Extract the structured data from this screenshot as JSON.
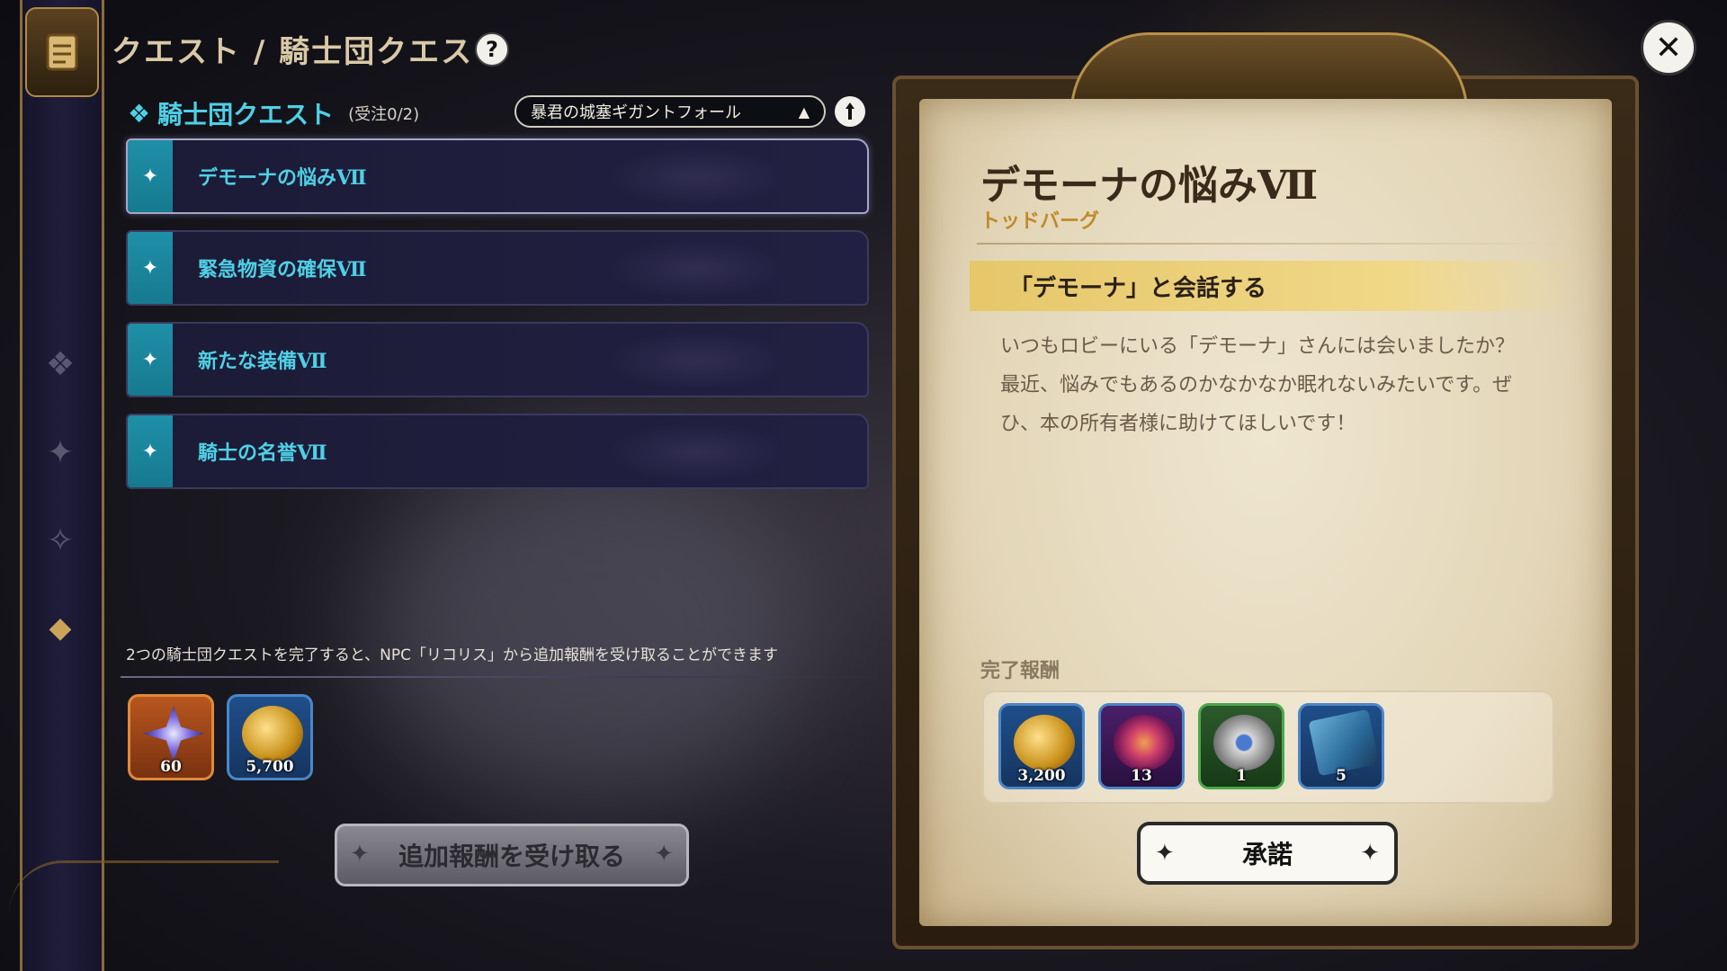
{
  "header": {
    "title": "クエスト / 騎士団クエスト",
    "help_icon": "?"
  },
  "sub_header": {
    "title": "騎士団クエスト",
    "count": "(受注0/2)"
  },
  "area_select": {
    "value": "暴君の城塞ギガントフォール",
    "arrow": "▲"
  },
  "quests": [
    {
      "label": "デモーナの悩みⅦ",
      "selected": true
    },
    {
      "label": "緊急物資の確保Ⅶ",
      "selected": false
    },
    {
      "label": "新たな装備Ⅶ",
      "selected": false
    },
    {
      "label": "騎士の名誉Ⅶ",
      "selected": false
    }
  ],
  "bonus": {
    "text": "2つの騎士団クエストを完了すると、NPC「リコリス」から追加報酬を受け取ることができます",
    "rewards": [
      {
        "icon": "crystal-star-icon",
        "qty": "60"
      },
      {
        "icon": "gold-coins-icon",
        "qty": "5,700"
      }
    ],
    "claim_label": "追加報酬を受け取る"
  },
  "detail": {
    "title": "デモーナの悩みⅦ",
    "location": "トッドバーグ",
    "objective": "「デモーナ」と会話する",
    "description": [
      "いつもロビーにいる「デモーナ」さんには会いましたか？",
      "最近、悩みでもあるのかなかなか眠れないみたいです。ぜひ、本の所有者様に助けてほしいです！"
    ],
    "rewards_label": "完了報酬",
    "rewards": [
      {
        "icon": "gold-coins-icon",
        "qty": "3,200"
      },
      {
        "icon": "swirl-orb-icon",
        "qty": "13"
      },
      {
        "icon": "silver-emblem-icon",
        "qty": "1"
      },
      {
        "icon": "blue-book-icon",
        "qty": "5"
      }
    ],
    "accept_label": "承諾"
  },
  "close_icon": "✕",
  "colors": {
    "accent_cyan": "#4fd0e6",
    "gold": "#c9a35a",
    "parchment": "#efe6d0"
  }
}
